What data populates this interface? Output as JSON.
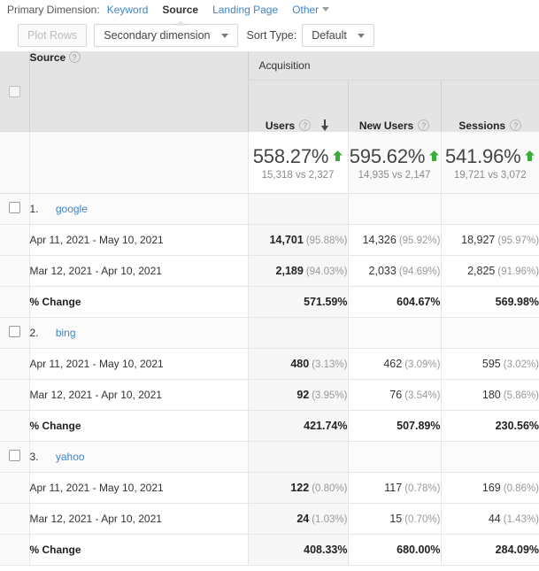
{
  "primary_dimension": {
    "label": "Primary Dimension:",
    "tabs": [
      {
        "label": "Keyword",
        "active": false,
        "has_caret": false
      },
      {
        "label": "Source",
        "active": true,
        "has_caret": false
      },
      {
        "label": "Landing Page",
        "active": false,
        "has_caret": false
      },
      {
        "label": "Other",
        "active": false,
        "has_caret": true
      }
    ]
  },
  "toolbar": {
    "plot_rows_label": "Plot Rows",
    "secondary_dimension_label": "Secondary dimension",
    "sort_type_label": "Sort Type:",
    "sort_type_value": "Default"
  },
  "table": {
    "group_header": "Acquisition",
    "dimension_header": "Source",
    "help_icon": "?",
    "columns": [
      {
        "label": "Users",
        "sorted": true,
        "sort_direction": "desc"
      },
      {
        "label": "New Users",
        "sorted": false
      },
      {
        "label": "Sessions",
        "sorted": false
      }
    ],
    "summary": [
      {
        "percent": "558.27%",
        "trend": "up",
        "comparison": "15,318 vs 2,327",
        "highlight": true
      },
      {
        "percent": "595.62%",
        "trend": "up",
        "comparison": "14,935 vs 2,147",
        "highlight": false
      },
      {
        "percent": "541.96%",
        "trend": "up",
        "comparison": "19,721 vs 3,072",
        "highlight": false
      }
    ],
    "change_row_label": "% Change",
    "rows": [
      {
        "rank": "1.",
        "name": "google",
        "current": {
          "date_range": "Apr 11, 2021 - May 10, 2021",
          "users": "14,701",
          "users_pct": "(95.88%)",
          "new_users": "14,326",
          "new_users_pct": "(95.92%)",
          "sessions": "18,927",
          "sessions_pct": "(95.97%)"
        },
        "previous": {
          "date_range": "Mar 12, 2021 - Apr 10, 2021",
          "users": "2,189",
          "users_pct": "(94.03%)",
          "new_users": "2,033",
          "new_users_pct": "(94.69%)",
          "sessions": "2,825",
          "sessions_pct": "(91.96%)"
        },
        "change": {
          "users": "571.59%",
          "new_users": "604.67%",
          "sessions": "569.98%"
        }
      },
      {
        "rank": "2.",
        "name": "bing",
        "current": {
          "date_range": "Apr 11, 2021 - May 10, 2021",
          "users": "480",
          "users_pct": "(3.13%)",
          "new_users": "462",
          "new_users_pct": "(3.09%)",
          "sessions": "595",
          "sessions_pct": "(3.02%)"
        },
        "previous": {
          "date_range": "Mar 12, 2021 - Apr 10, 2021",
          "users": "92",
          "users_pct": "(3.95%)",
          "new_users": "76",
          "new_users_pct": "(3.54%)",
          "sessions": "180",
          "sessions_pct": "(5.86%)"
        },
        "change": {
          "users": "421.74%",
          "new_users": "507.89%",
          "sessions": "230.56%"
        }
      },
      {
        "rank": "3.",
        "name": "yahoo",
        "current": {
          "date_range": "Apr 11, 2021 - May 10, 2021",
          "users": "122",
          "users_pct": "(0.80%)",
          "new_users": "117",
          "new_users_pct": "(0.78%)",
          "sessions": "169",
          "sessions_pct": "(0.86%)"
        },
        "previous": {
          "date_range": "Mar 12, 2021 - Apr 10, 2021",
          "users": "24",
          "users_pct": "(1.03%)",
          "new_users": "15",
          "new_users_pct": "(0.70%)",
          "sessions": "44",
          "sessions_pct": "(1.43%)"
        },
        "change": {
          "users": "408.33%",
          "new_users": "680.00%",
          "sessions": "284.09%"
        }
      }
    ]
  },
  "colors": {
    "link": "#4285c5",
    "trend_up": "#3aab3a",
    "header_bg": "#e4e4e4"
  }
}
